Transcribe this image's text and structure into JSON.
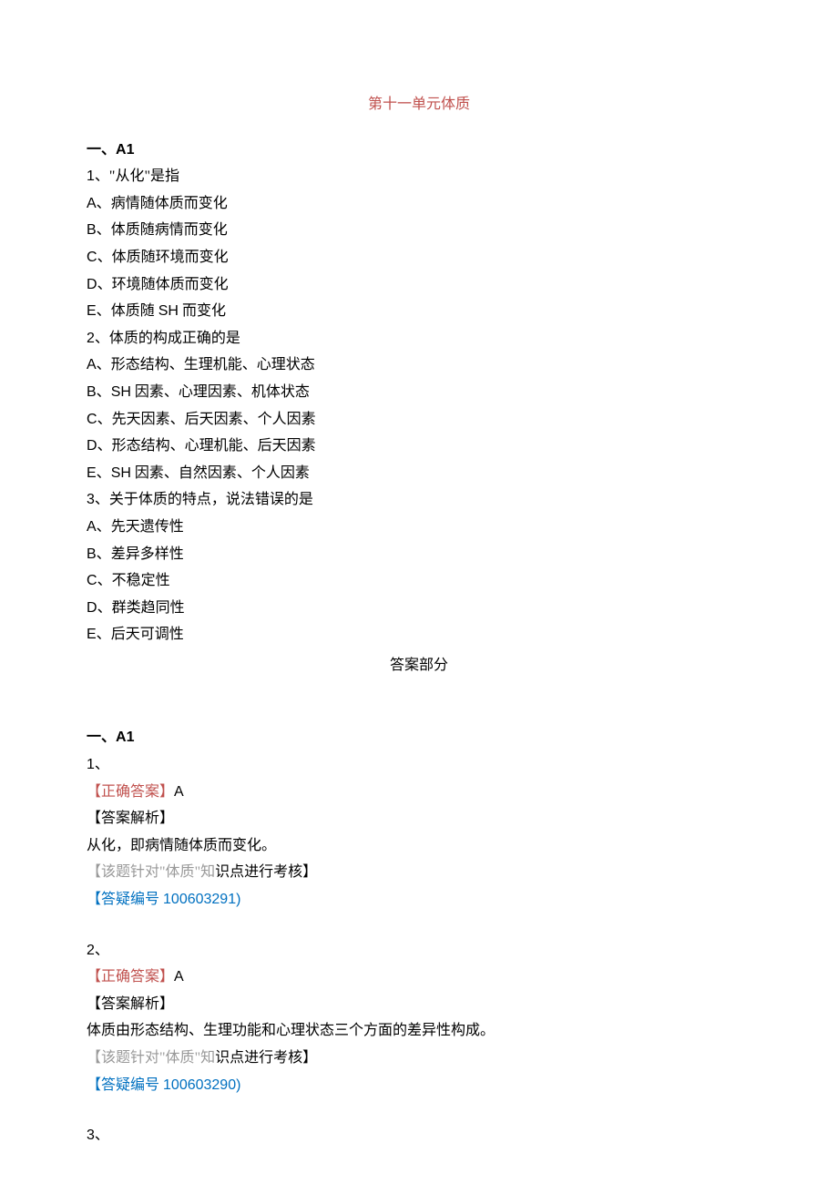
{
  "title": "第十一单元体质",
  "section_label_prefix": "一、",
  "section_label_code": "A1",
  "questions": {
    "q1": {
      "num": "1",
      "sep": "、",
      "stem": "\"从化\"是指",
      "opts": {
        "a": {
          "code": "A",
          "sep": "、",
          "text": "病情随体质而变化"
        },
        "b": {
          "code": "B",
          "sep": "、",
          "text": "体质随病情而变化"
        },
        "c": {
          "code": "C",
          "sep": "、",
          "text": "体质随环境而变化"
        },
        "d": {
          "code": "D",
          "sep": "、",
          "text": "环境随体质而变化"
        },
        "e": {
          "code": "E",
          "sep": "、",
          "text_before": "体质随 ",
          "text_mid": "SH",
          "text_after": " 而变化"
        }
      }
    },
    "q2": {
      "num": "2",
      "sep": "、",
      "stem": "体质的构成正确的是",
      "opts": {
        "a": {
          "code": "A",
          "sep": "、",
          "text": "形态结构、生理机能、心理状态"
        },
        "b": {
          "code": "B",
          "sep": "、",
          "text_before": "",
          "text_mid": "SH",
          "text_after": " 因素、心理因素、机体状态"
        },
        "c": {
          "code": "C",
          "sep": "、",
          "text": "先天因素、后天因素、个人因素"
        },
        "d": {
          "code": "D",
          "sep": "、",
          "text": "形态结构、心理机能、后天因素"
        },
        "e": {
          "code": "E",
          "sep": "、",
          "text_before": "",
          "text_mid": "SH",
          "text_after": " 因素、自然因素、个人因素"
        }
      }
    },
    "q3": {
      "num": "3",
      "sep": "、",
      "stem": "关于体质的特点，说法错误的是",
      "opts": {
        "a": {
          "code": "A",
          "sep": "、",
          "text": "先天遗传性"
        },
        "b": {
          "code": "B",
          "sep": "、",
          "text": "差异多样性"
        },
        "c": {
          "code": "C",
          "sep": "、",
          "text": "不稳定性"
        },
        "d": {
          "code": "D",
          "sep": "、",
          "text": "群类趋同性"
        },
        "e": {
          "code": "E",
          "sep": "、",
          "text": "后天可调性"
        }
      }
    }
  },
  "answers_header": "答案部分",
  "answers": {
    "a1": {
      "num": "1",
      "sep": "、",
      "correct_label": "【正确答案】",
      "correct_value": "A",
      "explain_label": "【答案解析】",
      "explain_text": "从化，即病情随体质而变化。",
      "topic_prefix": "【该题针对\"",
      "topic_word": "体质",
      "topic_suffix_a": "\"知",
      "topic_suffix_b": "识点进行考核】",
      "ref_prefix": "【答疑编号 ",
      "ref_num": "100603291",
      "ref_suffix": ")"
    },
    "a2": {
      "num": "2",
      "sep": "、",
      "correct_label": "【正确答案】",
      "correct_value": "A",
      "explain_label": "【答案解析】",
      "explain_text": "体质由形态结构、生理功能和心理状态三个方面的差异性构成。",
      "topic_prefix": "【该题针对\"",
      "topic_word": "体质",
      "topic_suffix_a": "\"知",
      "topic_suffix_b": "识点进行考核】",
      "ref_prefix": "【答疑编号 ",
      "ref_num": "100603290",
      "ref_suffix": ")"
    },
    "a3": {
      "num": "3",
      "sep": "、"
    }
  }
}
